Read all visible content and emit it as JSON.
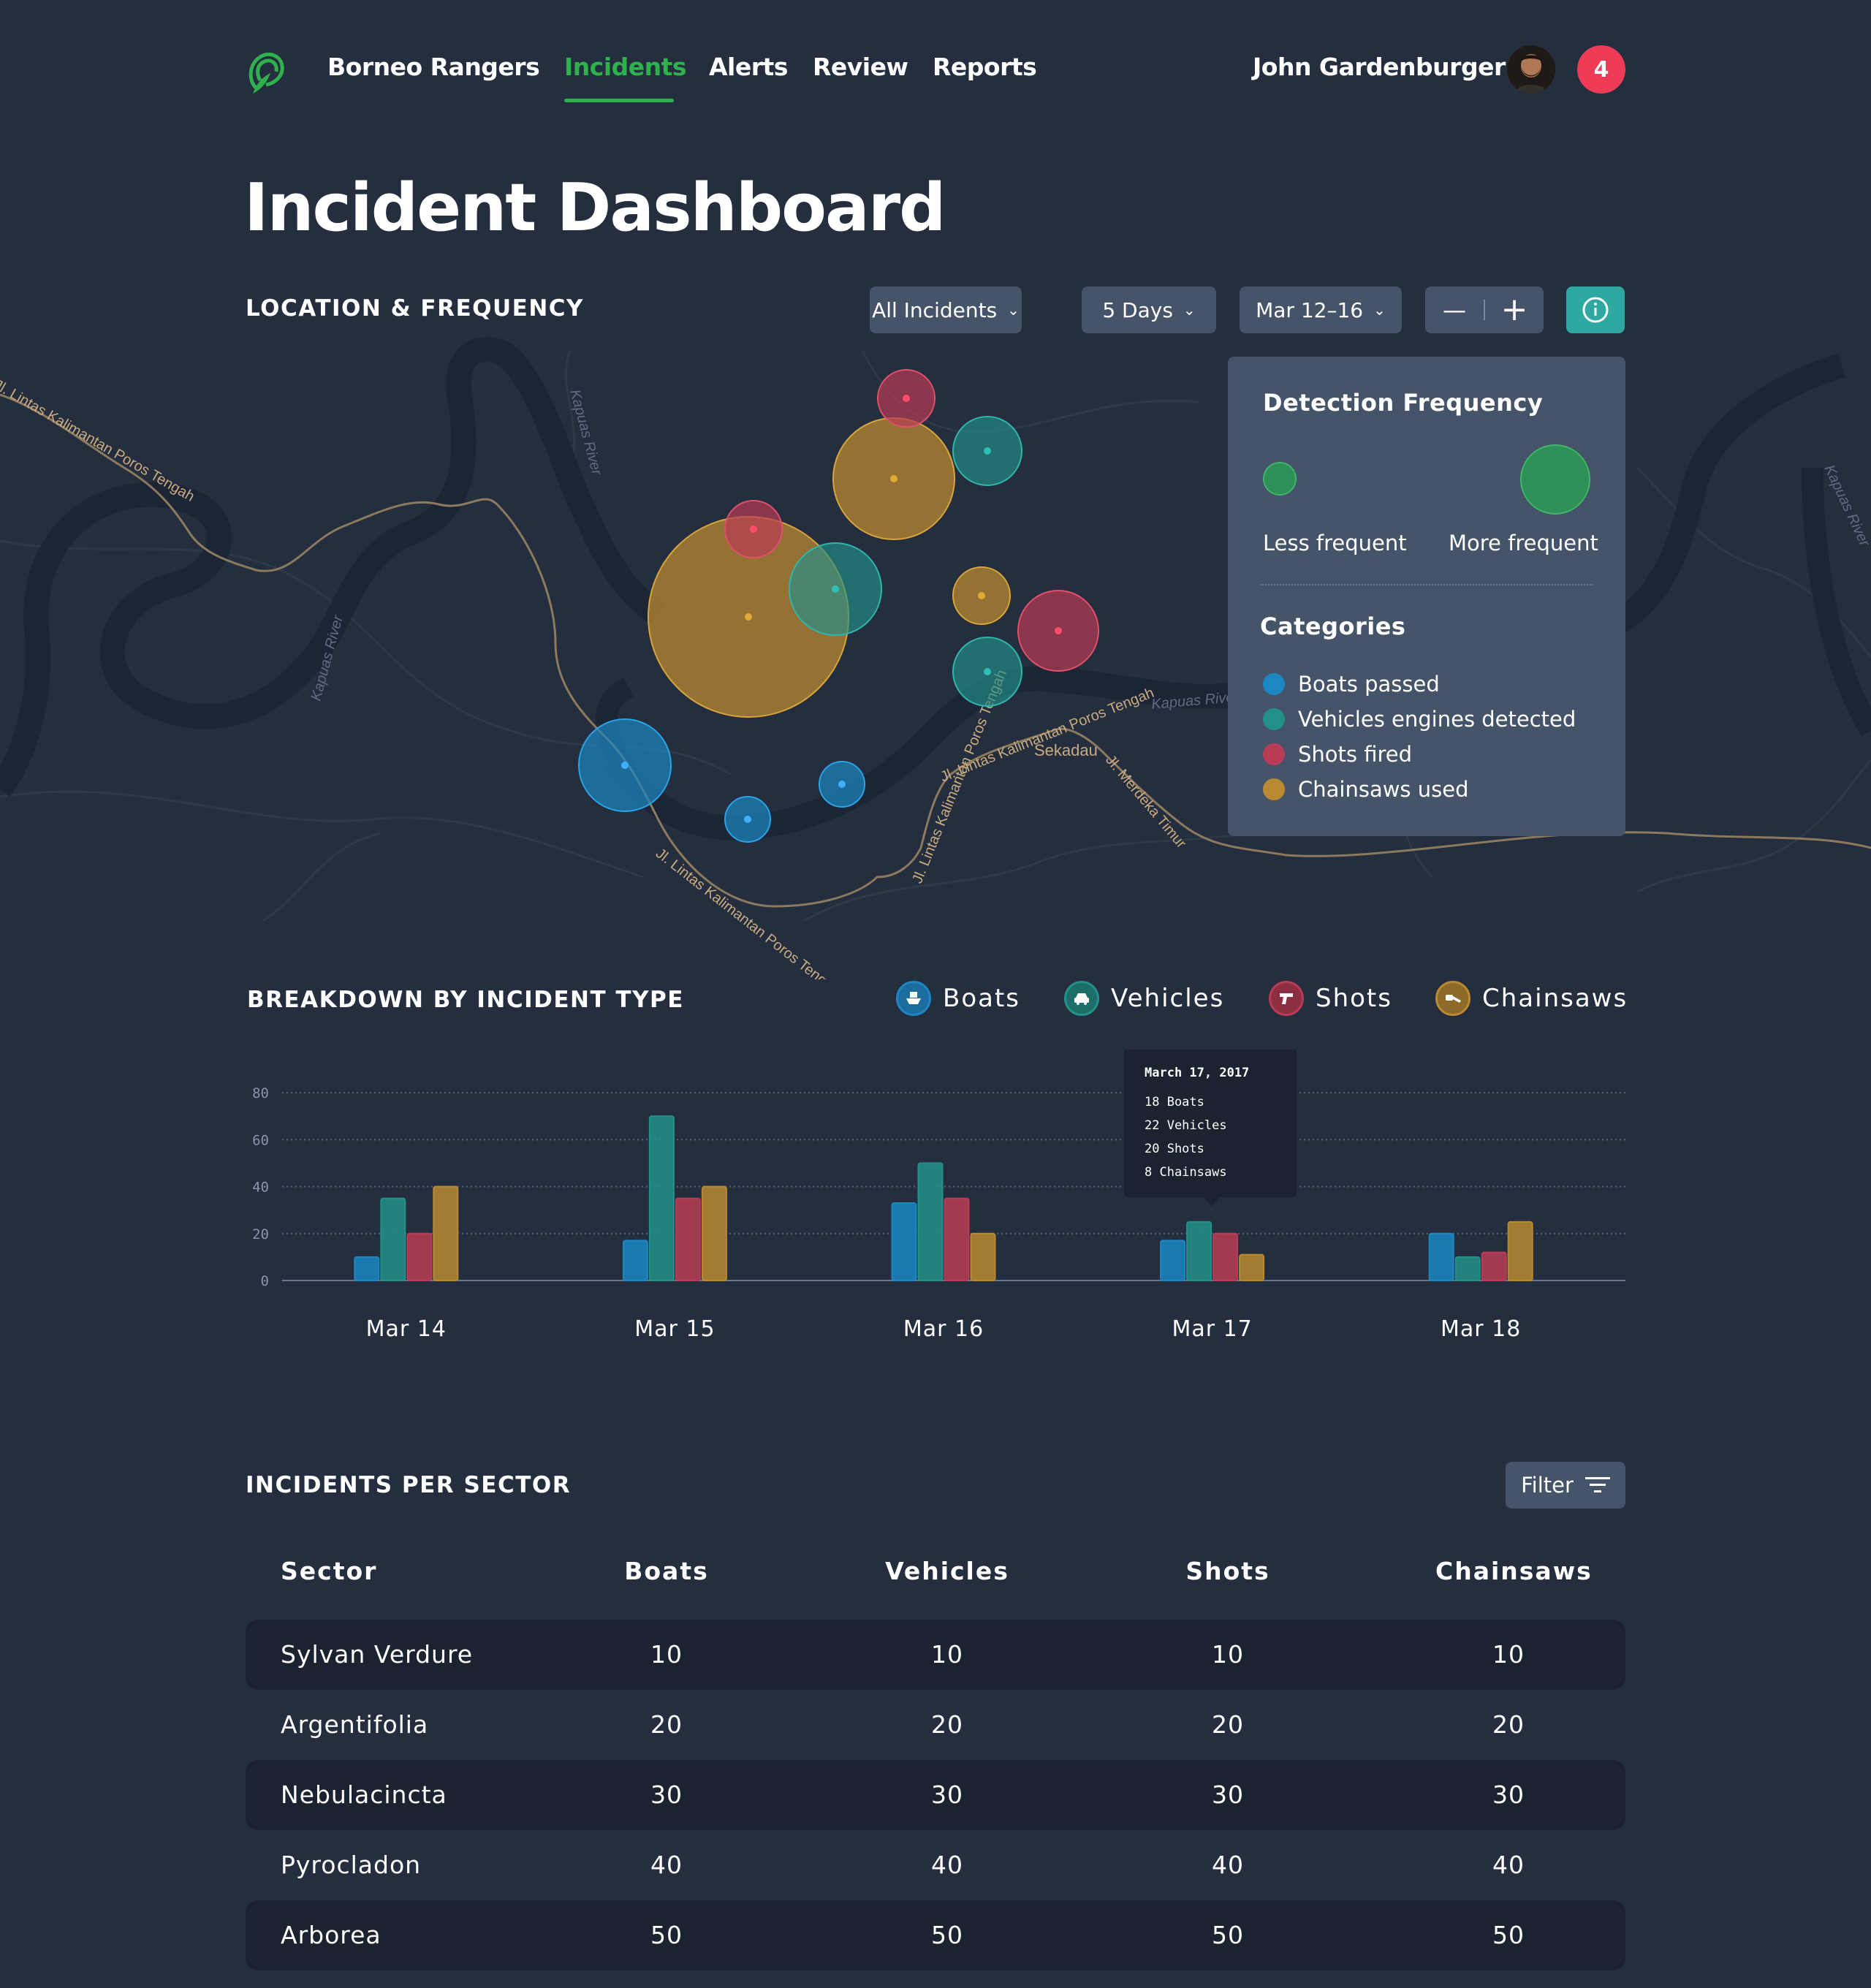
{
  "nav": {
    "brand": "Borneo Rangers",
    "items": [
      "Incidents",
      "Alerts",
      "Review",
      "Reports"
    ],
    "active": "Incidents",
    "user_name": "John Gardenburger",
    "notification_count": "4"
  },
  "page_title": "Incident Dashboard",
  "map_section": {
    "title": "LOCATION & FREQUENCY",
    "incident_filter": "All Incidents",
    "days_filter": "5 Days",
    "date_range": "Mar 12–16",
    "zoom_out": "—",
    "zoom_in": "+",
    "map_labels": [
      "Kapuas River",
      "Kapuas River",
      "Kapuas Rive",
      "Kapuas River",
      "Jl. Lintas Kalimantan Poros Tengah",
      "Jl. Lintas Kalimantan Poros Tengah",
      "Jl. Lintas Kalimantan Poros Tengah",
      "Jl. Lintas Kalimantan Poros Tengah",
      "Sekadau",
      "Jl. Merdeka Timur"
    ],
    "legend": {
      "frequency_title": "Detection Frequency",
      "less": "Less frequent",
      "more": "More frequent",
      "categories_title": "Categories",
      "categories": [
        {
          "label": "Boats passed",
          "color": "#1c87c2"
        },
        {
          "label": "Vehicles engines detected",
          "color": "#23918a"
        },
        {
          "label": "Shots fired",
          "color": "#b83c56"
        },
        {
          "label": "Chainsaws used",
          "color": "#b98a31"
        }
      ]
    }
  },
  "breakdown": {
    "title": "BREAKDOWN BY INCIDENT TYPE",
    "keys": [
      "Boats",
      "Vehicles",
      "Shots",
      "Chainsaws"
    ],
    "tooltip": {
      "date": "March 17, 2017",
      "lines": [
        "18 Boats",
        "22 Vehicles",
        "20 Shots",
        "8 Chainsaws"
      ]
    }
  },
  "chart_data": {
    "type": "bar",
    "categories": [
      "Mar 14",
      "Mar 15",
      "Mar 16",
      "Mar 17",
      "Mar 18"
    ],
    "series": [
      {
        "name": "Boats",
        "color": "#1c87c2",
        "values": [
          10,
          17,
          33,
          17,
          20
        ]
      },
      {
        "name": "Vehicles",
        "color": "#23918a",
        "values": [
          35,
          70,
          50,
          25,
          10
        ]
      },
      {
        "name": "Shots",
        "color": "#b83c56",
        "values": [
          20,
          35,
          35,
          20,
          12
        ]
      },
      {
        "name": "Chainsaws",
        "color": "#b98a31",
        "values": [
          40,
          40,
          20,
          11,
          25
        ]
      }
    ],
    "yticks": [
      "80",
      "60",
      "40",
      "20",
      "0"
    ],
    "ylim": [
      0,
      80
    ],
    "grid": true
  },
  "sector_table": {
    "title": "INCIDENTS PER SECTOR",
    "filter_label": "Filter",
    "headers": [
      "Sector",
      "Boats",
      "Vehicles",
      "Shots",
      "Chainsaws"
    ],
    "rows": [
      [
        "Sylvan Verdure",
        "10",
        "10",
        "10",
        "10"
      ],
      [
        "Argentifolia",
        "20",
        "20",
        "20",
        "20"
      ],
      [
        "Nebulacincta",
        "30",
        "30",
        "30",
        "30"
      ],
      [
        "Pyrocladon",
        "40",
        "40",
        "40",
        "40"
      ],
      [
        "Arborea",
        "50",
        "50",
        "50",
        "50"
      ]
    ]
  }
}
